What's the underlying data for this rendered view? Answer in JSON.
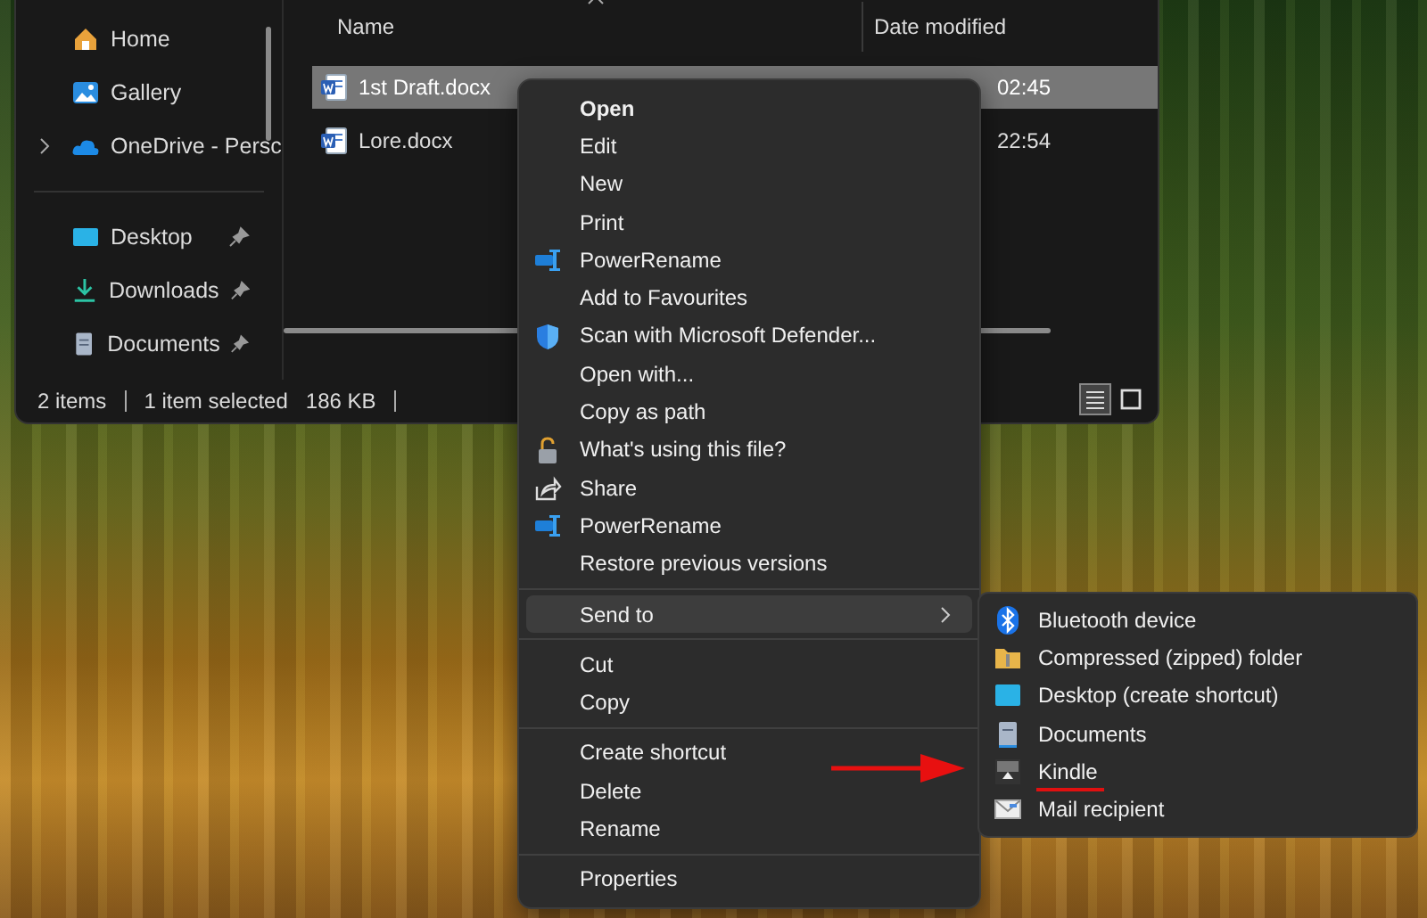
{
  "explorer": {
    "sidebar": {
      "sections": [
        {
          "items": [
            {
              "label": "Home",
              "pinned": false
            },
            {
              "label": "Gallery",
              "pinned": false
            },
            {
              "label": "OneDrive - Persc",
              "pinned": false,
              "expanded": false
            }
          ]
        },
        {
          "items": [
            {
              "label": "Desktop",
              "pinned": true
            },
            {
              "label": "Downloads",
              "pinned": true
            },
            {
              "label": "Documents",
              "pinned": true
            }
          ]
        }
      ]
    },
    "columns": [
      "Name",
      "Date modified"
    ],
    "files": [
      {
        "name": "1st Draft.docx",
        "date": "02:45",
        "selected": true
      },
      {
        "name": "Lore.docx",
        "date": "22:54",
        "selected": false
      }
    ],
    "status_bar": [
      "2 items",
      "1 item selected",
      "186 KB"
    ],
    "view_buttons": [
      {
        "selected": true
      },
      {
        "selected": false
      }
    ]
  },
  "context_menu": {
    "groups": [
      [
        {
          "label": "Open",
          "default": true,
          "selected": false
        },
        {
          "label": "Edit",
          "default": false,
          "selected": false
        },
        {
          "label": "New",
          "default": false,
          "selected": false
        },
        {
          "label": "Print",
          "default": false,
          "selected": false
        },
        {
          "label": "PowerRename",
          "default": false,
          "selected": false
        },
        {
          "label": "Add to Favourites",
          "default": false,
          "selected": false
        },
        {
          "label": "Scan with Microsoft Defender...",
          "default": false,
          "selected": false
        },
        {
          "label": "Open with...",
          "default": false,
          "selected": false
        },
        {
          "label": "Copy as path",
          "default": false,
          "selected": false
        },
        {
          "label": "What's using this file?",
          "default": false,
          "selected": false
        },
        {
          "label": "Share",
          "default": false,
          "selected": false
        },
        {
          "label": "PowerRename",
          "default": false,
          "selected": false
        },
        {
          "label": "Restore previous versions",
          "default": false,
          "selected": false
        }
      ],
      [
        {
          "label": "Send to",
          "default": false,
          "selected": true,
          "submenu": [
            {
              "label": "Bluetooth device",
              "underlined": false
            },
            {
              "label": "Compressed (zipped) folder",
              "underlined": false
            },
            {
              "label": "Desktop (create shortcut)",
              "underlined": false
            },
            {
              "label": "Documents",
              "underlined": false
            },
            {
              "label": "Kindle",
              "underlined": true
            },
            {
              "label": "Mail recipient",
              "underlined": false
            }
          ]
        }
      ],
      [
        {
          "label": "Cut",
          "default": false,
          "selected": false
        },
        {
          "label": "Copy",
          "default": false,
          "selected": false
        }
      ],
      [
        {
          "label": "Create shortcut",
          "default": false,
          "selected": false
        },
        {
          "label": "Delete",
          "default": false,
          "selected": false
        },
        {
          "label": "Rename",
          "default": false,
          "selected": false
        }
      ],
      [
        {
          "label": "Properties",
          "default": false,
          "selected": false
        }
      ]
    ]
  }
}
